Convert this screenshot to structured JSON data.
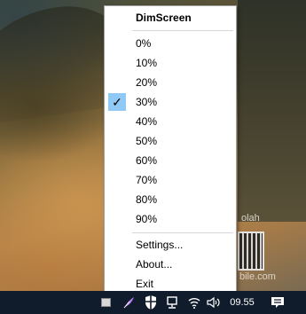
{
  "menu": {
    "title": "DimScreen",
    "levels": [
      "0%",
      "10%",
      "20%",
      "30%",
      "40%",
      "50%",
      "60%",
      "70%",
      "80%",
      "90%"
    ],
    "checked_level": "30%",
    "check_mark": "✓",
    "settings": "Settings...",
    "about": "About...",
    "exit": "Exit"
  },
  "wallpaper": {
    "watermark_top": "olah",
    "watermark_bottom": "bile.com"
  },
  "taskbar": {
    "clock": "09.55",
    "icons": [
      "show-hidden-icon",
      "feather-app-icon",
      "shield-security-icon",
      "network-icon",
      "wifi-icon",
      "volume-icon",
      "notification-icon"
    ]
  },
  "colors": {
    "menu_background": "#ffffff",
    "check_highlight": "#90c8f6",
    "taskbar_background": "#101c2c"
  }
}
